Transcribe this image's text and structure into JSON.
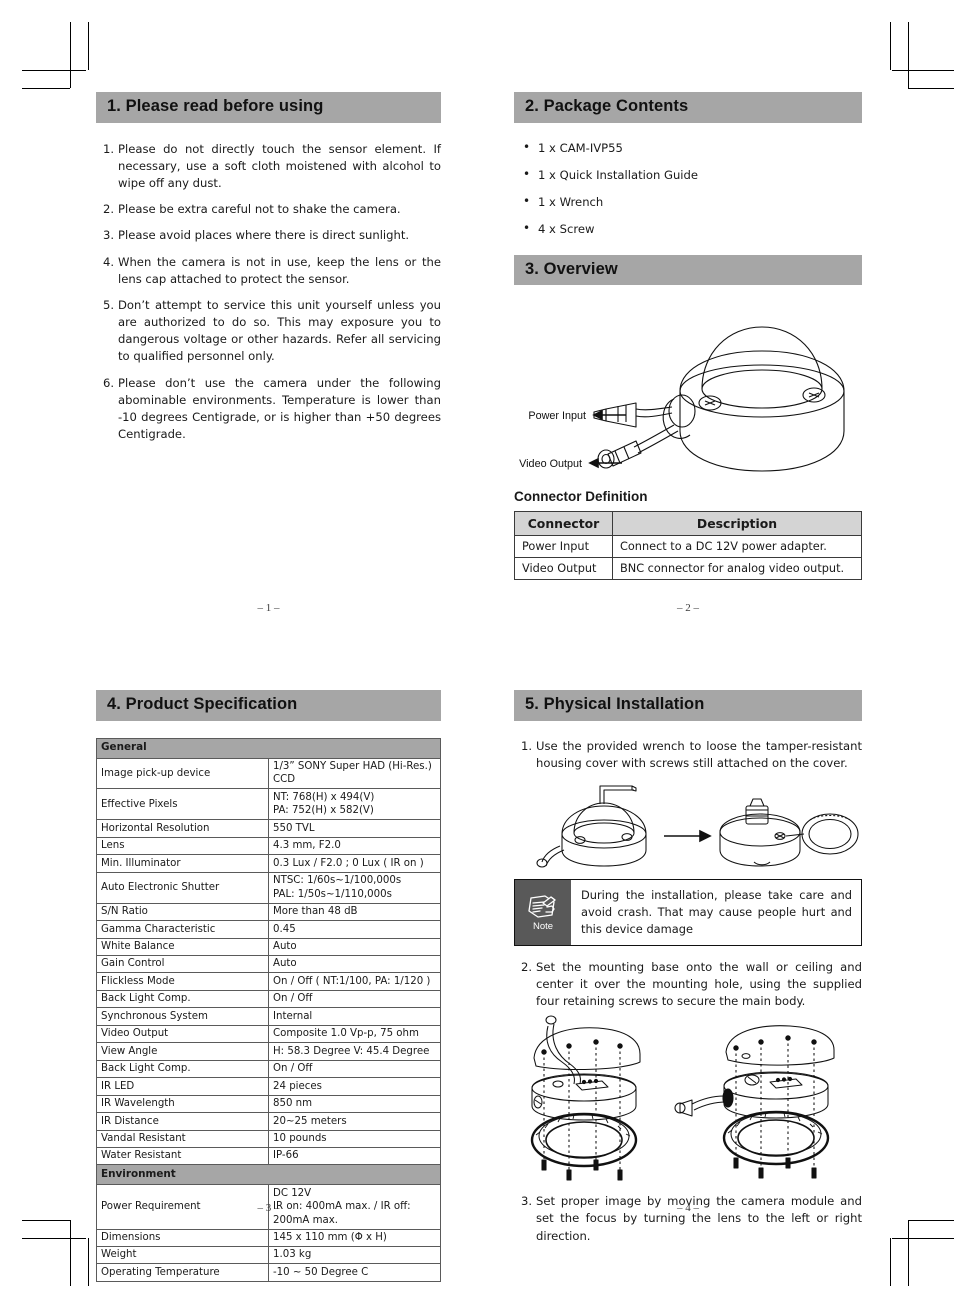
{
  "document": {
    "type": "quick-installation-guide",
    "product": "CAM-IVP55"
  },
  "page1": {
    "heading": "1. Please read before using",
    "items": [
      "Please do not directly touch the sensor element. If necessary, use a soft cloth moistened with alcohol to wipe off any dust.",
      "Please be extra careful not to shake the camera.",
      "Please avoid places where there is direct sunlight.",
      "When the camera is not in use, keep the lens or the lens cap attached to protect the sensor.",
      "Don’t attempt to service this unit yourself unless you are authorized to do so. This may exposure you to dangerous voltage or other hazards. Refer all servicing to qualified personnel only.",
      "Please don’t use the camera under the following abominable environments. Temperature is lower than -10 degrees Centigrade, or is higher than +50 degrees Centigrade."
    ],
    "numbers": [
      "1.",
      "2.",
      "3.",
      "4.",
      "5.",
      "6."
    ],
    "footer": "– 1 –"
  },
  "page2": {
    "package_heading": "2. Package Contents",
    "package_items": [
      "1 x CAM-IVP55",
      "1 x Quick Installation Guide",
      "1 x Wrench",
      "4 x Screw"
    ],
    "overview_heading": "3. Overview",
    "diagram": {
      "label_power": "Power Input",
      "label_video": "Video Output"
    },
    "connector_subhead": "Connector Definition",
    "connector_table": {
      "headers": [
        "Connector",
        "Description"
      ],
      "rows": [
        [
          "Power Input",
          "Connect to a DC 12V power adapter."
        ],
        [
          "Video Output",
          "BNC connector for analog video output."
        ]
      ]
    },
    "footer": "– 2 –"
  },
  "page3": {
    "heading": "4. Product Specification",
    "spec_groups": [
      {
        "group": "General",
        "rows": [
          [
            "Image pick-up device",
            "1/3” SONY Super HAD (Hi-Res.) CCD"
          ],
          [
            "Effective Pixels",
            "NT: 768(H) x 494(V)\nPA: 752(H) x 582(V)"
          ],
          [
            "Horizontal Resolution",
            "550 TVL"
          ],
          [
            "Lens",
            "4.3 mm, F2.0"
          ],
          [
            "Min. Illuminator",
            "0.3 Lux / F2.0 ; 0 Lux ( IR on )"
          ],
          [
            "Auto Electronic Shutter",
            "NTSC: 1/60s~1/100,000s\nPAL: 1/50s~1/110,000s"
          ],
          [
            "S/N Ratio",
            "More than 48 dB"
          ],
          [
            "Gamma Characteristic",
            "0.45"
          ],
          [
            "White Balance",
            "Auto"
          ],
          [
            "Gain Control",
            "Auto"
          ],
          [
            "Flickless Mode",
            "On / Off ( NT:1/100, PA: 1/120 )"
          ],
          [
            "Back Light Comp.",
            "On / Off"
          ],
          [
            "Synchronous System",
            "Internal"
          ],
          [
            "Video Output",
            "Composite 1.0 Vp-p, 75 ohm"
          ],
          [
            "View Angle",
            "H: 58.3 Degree V: 45.4 Degree"
          ],
          [
            "Back Light Comp.",
            "On / Off"
          ],
          [
            "IR LED",
            "24 pieces"
          ],
          [
            "IR Wavelength",
            "850 nm"
          ],
          [
            "IR Distance",
            "20~25 meters"
          ],
          [
            "Vandal Resistant",
            "10 pounds"
          ],
          [
            "Water Resistant",
            "IP-66"
          ]
        ]
      },
      {
        "group": "Environment",
        "rows": [
          [
            "Power Requirement",
            "DC 12V\nIR on: 400mA max. / IR off: 200mA max."
          ],
          [
            "Dimensions",
            "145 x 110 mm (Φ x H)"
          ],
          [
            "Weight",
            "1.03 kg"
          ],
          [
            "Operating Temperature",
            "-10 ~ 50 Degree C"
          ]
        ]
      }
    ],
    "footer": "– 3 –"
  },
  "page4": {
    "heading": "5. Physical Installation",
    "step1_num": "1.",
    "step1": "Use the provided wrench to loose the tamper-resistant housing cover with screws still attached on the cover.",
    "note_label": "Note",
    "note_text": "During the installation, please take care and avoid crash. That may cause people hurt and this device damage",
    "step2_num": "2.",
    "step2": "Set the mounting base onto the wall or ceiling and center it over the mounting hole, using the supplied four retaining screws to secure the main body.",
    "step3_num": "3.",
    "step3": "Set proper image by moving the camera module and set the focus by turning the lens to the left or right direction.",
    "footer": "– 4 –"
  },
  "colors": {
    "section_bar": "#a6a6a6",
    "table_header": "#d4d4d4",
    "note_tag": "#595959",
    "text": "#1a1a1a"
  }
}
